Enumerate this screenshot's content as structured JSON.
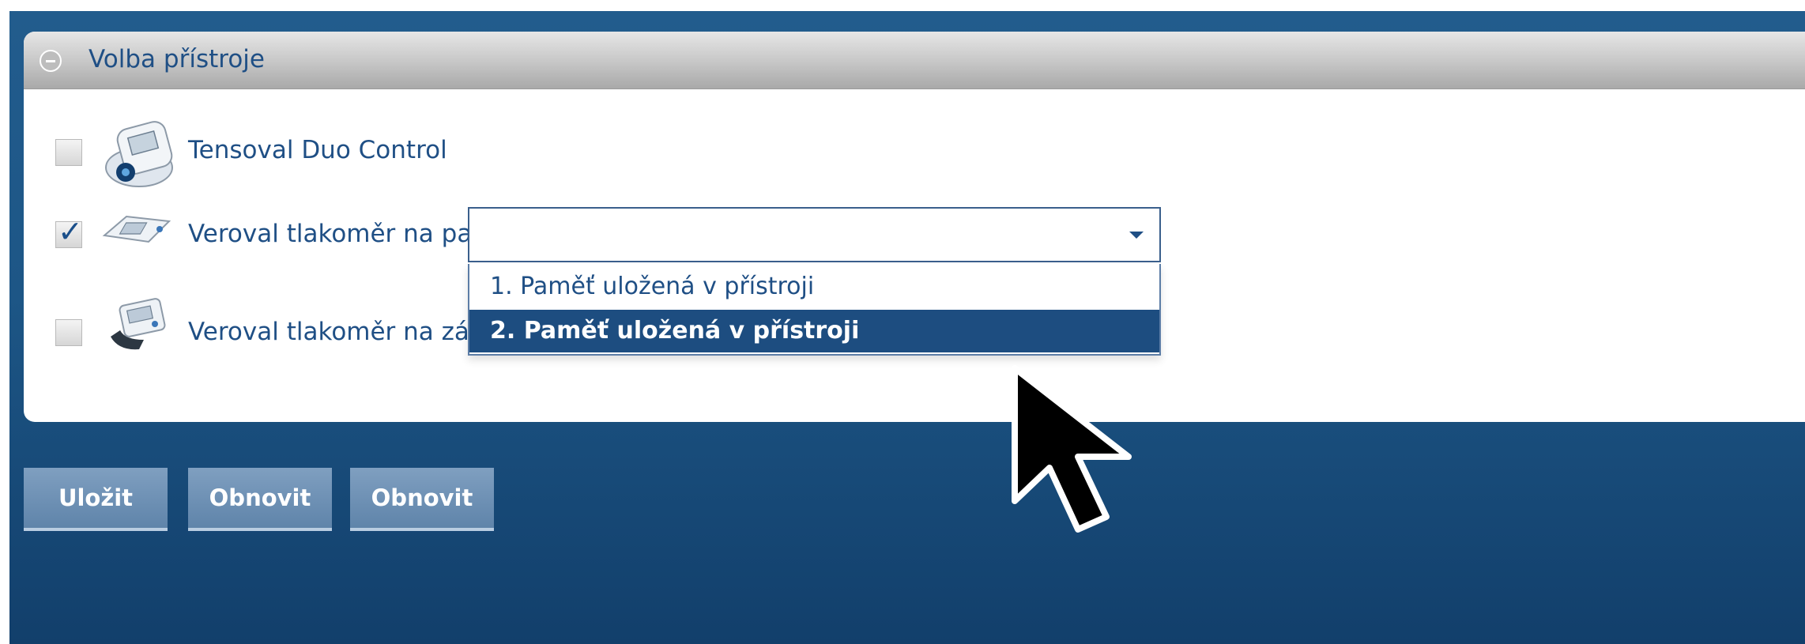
{
  "panel": {
    "title": "Volba přístroje"
  },
  "devices": [
    {
      "label": "Tensoval Duo Control",
      "checked": false,
      "icon": "blood-pressure-monitor-icon"
    },
    {
      "label": "Veroval tlakoměr na paži",
      "checked": true,
      "check_glyph": "✓",
      "icon": "upper-arm-monitor-icon"
    },
    {
      "label": "Veroval tlakoměr na zápěstí",
      "checked": false,
      "icon": "wrist-monitor-icon"
    }
  ],
  "memory_select": {
    "value": "",
    "options": [
      "1. Paměť uložená v přístroji",
      "2. Paměť uložená v přístroji"
    ],
    "highlighted_index": 1
  },
  "buttons": {
    "save": "Uložit",
    "refresh1": "Obnovit",
    "refresh2": "Obnovit"
  },
  "colors": {
    "background_blue": "#1d5686",
    "highlight": "#1d4d80",
    "text": "#1f4f85"
  }
}
